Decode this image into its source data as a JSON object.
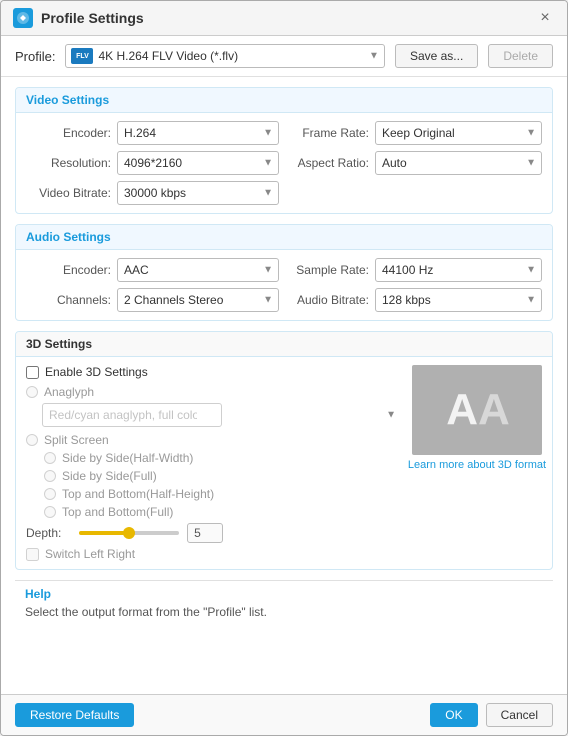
{
  "titleBar": {
    "title": "Profile Settings",
    "closeLabel": "×"
  },
  "profile": {
    "label": "Profile:",
    "value": "4K H.264 FLV Video (*.flv)",
    "formatBadge": "FLV",
    "saveAsLabel": "Save as...",
    "deleteLabel": "Delete"
  },
  "videoSettings": {
    "sectionTitle": "Video Settings",
    "encoderLabel": "Encoder:",
    "encoderValue": "H.264",
    "resolutionLabel": "Resolution:",
    "resolutionValue": "4096*2160",
    "videoBitrateLabel": "Video Bitrate:",
    "videoBitrateValue": "30000 kbps",
    "frameRateLabel": "Frame Rate:",
    "frameRateValue": "Keep Original",
    "aspectRatioLabel": "Aspect Ratio:",
    "aspectRatioValue": "Auto"
  },
  "audioSettings": {
    "sectionTitle": "Audio Settings",
    "encoderLabel": "Encoder:",
    "encoderValue": "AAC",
    "channelsLabel": "Channels:",
    "channelsValue": "2 Channels Stereo",
    "sampleRateLabel": "Sample Rate:",
    "sampleRateValue": "44100 Hz",
    "audioBitrateLabel": "Audio Bitrate:",
    "audioBitrateValue": "128 kbps"
  },
  "threeDSettings": {
    "sectionTitle": "3D Settings",
    "enableLabel": "Enable 3D Settings",
    "anaglyphLabel": "Anaglyph",
    "anaglyphValue": "Red/cyan anaglyph, full color",
    "splitScreenLabel": "Split Screen",
    "splitOptions": [
      "Side by Side(Half-Width)",
      "Side by Side(Full)",
      "Top and Bottom(Half-Height)",
      "Top and Bottom(Full)"
    ],
    "depthLabel": "Depth:",
    "depthValue": "5",
    "switchLabel": "Switch Left Right",
    "learnMoreLabel": "Learn more about 3D format",
    "previewLetters": [
      "A",
      "A"
    ]
  },
  "help": {
    "title": "Help",
    "text": "Select the output format from the \"Profile\" list."
  },
  "footer": {
    "restoreDefaultsLabel": "Restore Defaults",
    "okLabel": "OK",
    "cancelLabel": "Cancel"
  }
}
